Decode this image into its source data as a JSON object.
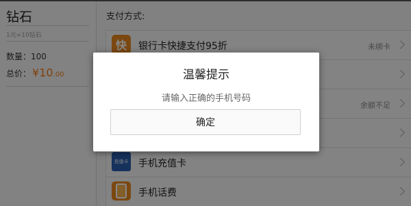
{
  "product": {
    "title": "钻石",
    "rate": "1元=10钻石",
    "quantity": "数量：100",
    "total_label": "总价：",
    "currency": "¥",
    "total_int": "10",
    "total_dec": ".00"
  },
  "payment": {
    "section_title": "支付方式:",
    "methods": [
      {
        "label": "银行卡快捷支付95折",
        "status": "未绑卡",
        "icon": "quick-pay-icon",
        "icon_text": "快"
      },
      {
        "label": "",
        "status": "",
        "icon": "wallet-icon"
      },
      {
        "label": "",
        "status": "余额不足",
        "icon": "balance-icon"
      },
      {
        "label": "",
        "status": "",
        "icon": "hidden-method-icon"
      },
      {
        "label": "手机充值卡",
        "status": "",
        "icon": "recharge-card-icon",
        "icon_text": "充值卡"
      },
      {
        "label": "手机话费",
        "status": "",
        "icon": "phone-bill-icon"
      }
    ]
  },
  "dialog": {
    "title": "温馨提示",
    "message": "请输入正确的手机号码",
    "confirm_label": "确定"
  }
}
